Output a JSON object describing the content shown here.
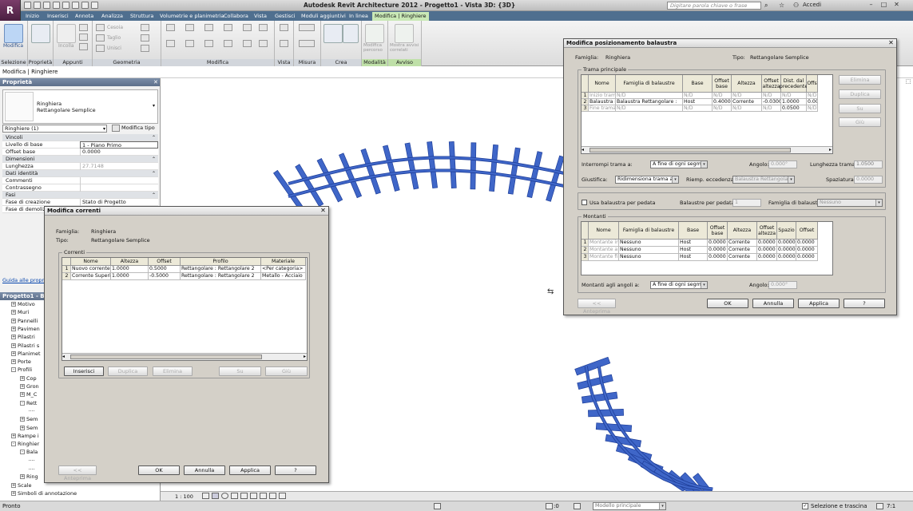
{
  "app": {
    "title": "Autodesk Revit Architecture 2012 -    Progetto1 - Vista 3D: {3D}",
    "search_placeholder": "Digitare parola chiave o frase",
    "login": "Accedi",
    "logo": "R"
  },
  "tabs": [
    "Inizio",
    "Inserisci",
    "Annota",
    "Analizza",
    "Struttura",
    "Volumetrie e planimetria",
    "Collabora",
    "Vista",
    "Gestisci",
    "Moduli aggiuntivi",
    "In linea",
    "Modifica | Ringhiere"
  ],
  "ribbon": {
    "panels": [
      "Selezione",
      "Proprietà",
      "Appunti",
      "Geometria",
      "Modifica",
      "Vista",
      "Misura",
      "Crea",
      "Modalità",
      "Avviso"
    ],
    "buttons": {
      "modifica": "Modifica",
      "incolla": "Incolla",
      "cesoia": "Cesoia",
      "taglio": "Taglio",
      "unisci": "Unisci",
      "modifica_percorso": "Modifica percorso",
      "mostra_avvisi": "Mostra avvisi correlati"
    }
  },
  "context_line": "Modifica | Ringhiere",
  "properties": {
    "header": "Proprietà",
    "type_name": "Ringhiera",
    "type_sub": "Rettangolare Semplice",
    "instance_select": "Ringhiere (1)",
    "edit_type": "Modifica tipo",
    "rows": [
      {
        "k": "Vincoli",
        "cat": true
      },
      {
        "k": "Livello di base",
        "v": "1 - Piano Primo"
      },
      {
        "k": "Offset base",
        "v": "0.0000"
      },
      {
        "k": "Dimensioni",
        "cat": true
      },
      {
        "k": "Lunghezza",
        "v": "27.7148",
        "ro": true
      },
      {
        "k": "Dati identità",
        "cat": true
      },
      {
        "k": "Commenti",
        "v": ""
      },
      {
        "k": "Contrassegno",
        "v": ""
      },
      {
        "k": "Fasi",
        "cat": true
      },
      {
        "k": "Fase di creazione",
        "v": "Stato di Progetto"
      },
      {
        "k": "Fase di demolizio",
        "v": ""
      }
    ],
    "help_link": "Guida alle propr"
  },
  "browser": {
    "header": "Progetto1 - Bro",
    "items": [
      {
        "t": "Motivo",
        "lvl": 1,
        "box": "+"
      },
      {
        "t": "Muri",
        "lvl": 1,
        "box": "+"
      },
      {
        "t": "Pannelli",
        "lvl": 1,
        "box": "+"
      },
      {
        "t": "Pavimen",
        "lvl": 1,
        "box": "+"
      },
      {
        "t": "Pilastri",
        "lvl": 1,
        "box": "+"
      },
      {
        "t": "Pilastri s",
        "lvl": 1,
        "box": "+"
      },
      {
        "t": "Planimet",
        "lvl": 1,
        "box": "+"
      },
      {
        "t": "Porte",
        "lvl": 1,
        "box": "+"
      },
      {
        "t": "Profili",
        "lvl": 1,
        "box": "-"
      },
      {
        "t": "Cop",
        "lvl": 2,
        "box": "+"
      },
      {
        "t": "Gron",
        "lvl": 2,
        "box": "+"
      },
      {
        "t": "M_C",
        "lvl": 2,
        "box": "+"
      },
      {
        "t": "Rett",
        "lvl": 2,
        "box": "-"
      },
      {
        "t": "",
        "lvl": 3,
        "box": ""
      },
      {
        "t": "Sem",
        "lvl": 2,
        "box": "+"
      },
      {
        "t": "Sem",
        "lvl": 2,
        "box": "+"
      },
      {
        "t": "Rampe i",
        "lvl": 1,
        "box": "+"
      },
      {
        "t": "Ringhier",
        "lvl": 1,
        "box": "-"
      },
      {
        "t": "Bala",
        "lvl": 2,
        "box": "-"
      },
      {
        "t": "",
        "lvl": 3,
        "box": ""
      },
      {
        "t": "",
        "lvl": 3,
        "box": ""
      },
      {
        "t": "Ring",
        "lvl": 2,
        "box": "+"
      },
      {
        "t": "Scale",
        "lvl": 1,
        "box": "+"
      },
      {
        "t": "Simboli di annotazione",
        "lvl": 1,
        "box": "+"
      }
    ]
  },
  "viewbar": {
    "scale": "1 : 100"
  },
  "status": {
    "left": "Pronto",
    "count": ":0",
    "model": "Modello principale",
    "select": "Selezione e trascina",
    "filter": "7:1"
  },
  "dlg_correnti": {
    "title": "Modifica correnti",
    "famiglia_label": "Famiglia:",
    "famiglia": "Ringhiera",
    "tipo_label": "Tipo:",
    "tipo": "Rettangolare Semplice",
    "group": "Correnti",
    "headers": [
      "Nome",
      "Altezza",
      "Offset",
      "Profilo",
      "Materiale"
    ],
    "rows": [
      [
        "1",
        "Nuovo corrente",
        "1.0000",
        "0.5000",
        "Rettangolare : Rettangolare 2",
        "<Per categoria>"
      ],
      [
        "2",
        "Corrente Superi",
        "1.0000",
        "-0.5000",
        "Rettangolare : Rettangolare 2",
        "Metallo - Acciaio"
      ]
    ],
    "buttons": {
      "inserisci": "Inserisci",
      "duplica": "Duplica",
      "elimina": "Elimina",
      "su": "Su",
      "giu": "Giù",
      "anteprima": "<< Anteprima",
      "ok": "OK",
      "annulla": "Annulla",
      "applica": "Applica",
      "help": "?"
    }
  },
  "dlg_balaustra": {
    "title": "Modifica posizionamento balaustra",
    "famiglia_label": "Famiglia:",
    "famiglia": "Ringhiera",
    "tipo_label": "Tipo:",
    "tipo": "Rettangolare Semplice",
    "group_main": "Trama principale",
    "headers": [
      "Nome",
      "Famiglia di balaustre",
      "Base",
      "Offset base",
      "Altezza",
      "Offset altezza",
      "Dist. dal precedente",
      "Offs"
    ],
    "rows": [
      [
        "1",
        "Inizio trama",
        "N/D",
        "N/D",
        "N/D",
        "N/D",
        "N/D",
        "N/D",
        "N/D"
      ],
      [
        "2",
        "Balaustra re",
        "Balaustra Rettangolare :",
        "Host",
        "0.4000",
        "Corrente",
        "-0.0300",
        "1.0000",
        "0.000"
      ],
      [
        "3",
        "Fine trama",
        "N/D",
        "N/D",
        "N/D",
        "N/D",
        "N/D",
        "0.0500",
        "N/D"
      ]
    ],
    "side_buttons": {
      "elimina": "Elimina",
      "duplica": "Duplica",
      "su": "Su",
      "giu": "Giù"
    },
    "interrompi_label": "Interrompi trama a:",
    "interrompi": "A fine di ogni segmen",
    "angolo_label": "Angolo:",
    "angolo": "0.000°",
    "lunghezza_label": "Lunghezza trama:",
    "lunghezza": "1.0500",
    "giustifica_label": "Giustifica:",
    "giustifica": "Ridimensiona trama alla",
    "riemp_label": "Riemp. eccedenza:",
    "riemp": "Balaustra Rettangolare",
    "spaziatura_label": "Spaziatura:",
    "spaziatura": "0.0000",
    "usa_label": "Usa balaustra per pedata",
    "per_pedata_label": "Balaustre per pedata:",
    "per_pedata": "1",
    "fam_bal_label": "Famiglia di balaustre:",
    "fam_bal": "Nessuno",
    "group_montanti": "Montanti",
    "m_headers": [
      "Nome",
      "Famiglia di balaustre",
      "Base",
      "Offset base",
      "Altezza",
      "Offset altezza",
      "Spazio",
      "Offset"
    ],
    "m_rows": [
      [
        "1",
        "Montante in",
        "Nessuno",
        "Host",
        "0.0000",
        "Corrente",
        "0.0000",
        "0.0000",
        "0.0000"
      ],
      [
        "2",
        "Montante a",
        "Nessuno",
        "Host",
        "0.0000",
        "Corrente",
        "0.0000",
        "0.0000",
        "0.0000"
      ],
      [
        "3",
        "Montante fi",
        "Nessuno",
        "Host",
        "0.0000",
        "Corrente",
        "0.0000",
        "0.0000",
        "0.0000"
      ]
    ],
    "montanti_angoli_label": "Montanti agli angoli a:",
    "montanti_angoli": "A fine di ogni segmen",
    "m_angolo_label": "Angolo:",
    "m_angolo": "0.000°",
    "buttons": {
      "anteprima": "<< Anteprima",
      "ok": "OK",
      "annulla": "Annulla",
      "applica": "Applica",
      "help": "?"
    }
  },
  "colors": {
    "rail": "#3f66c8",
    "rail_dark": "#1f3f9a",
    "tabbar": "#4f6f8f",
    "context_tab": "#c9e8b6"
  }
}
